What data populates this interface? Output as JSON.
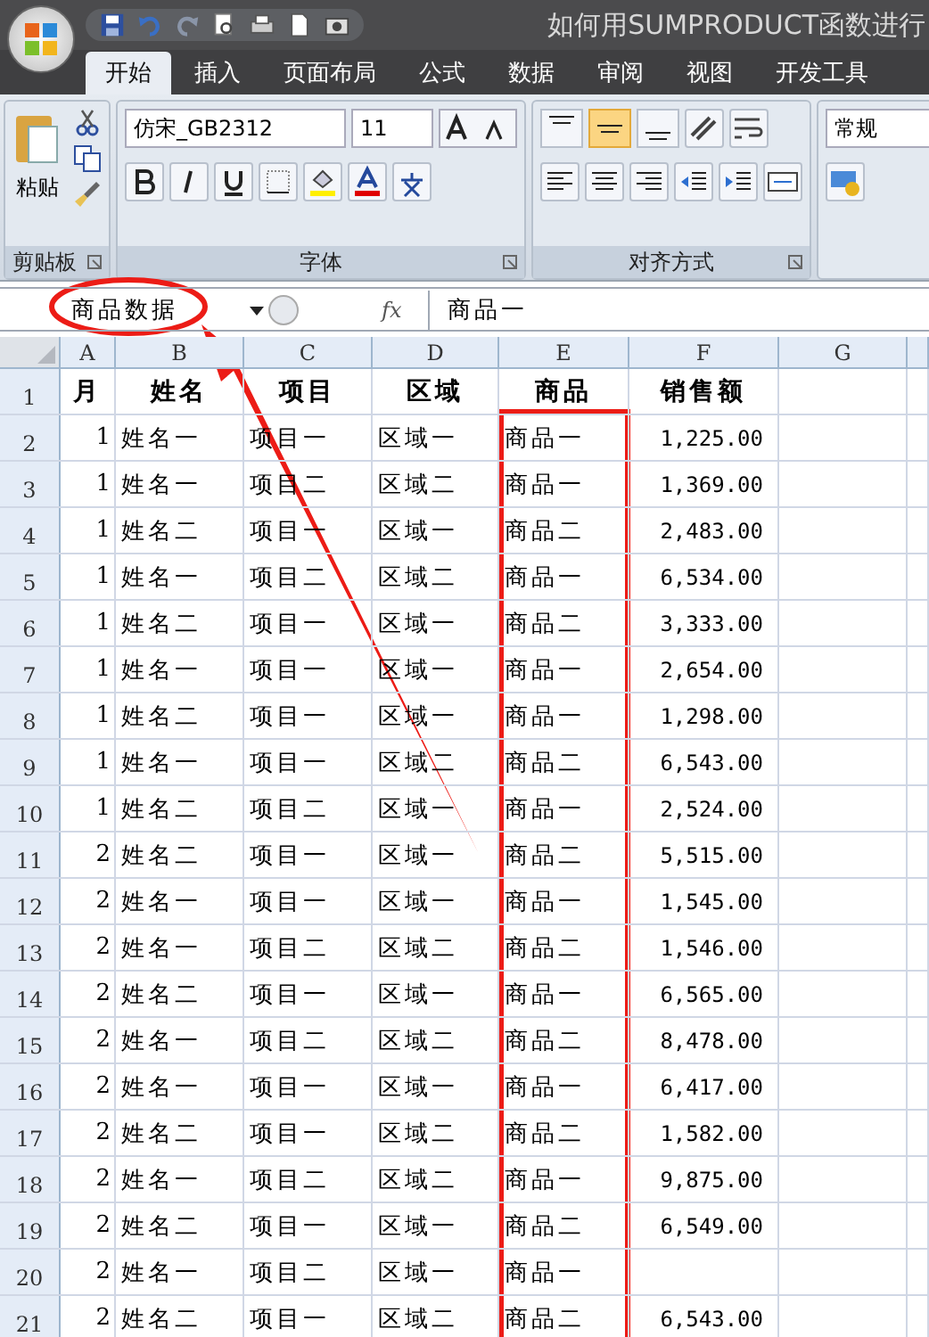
{
  "window": {
    "title": "如何用SUMPRODUCT函数进行"
  },
  "tabs": [
    {
      "label": "开始",
      "selected": true
    },
    {
      "label": "插入",
      "selected": false
    },
    {
      "label": "页面布局",
      "selected": false
    },
    {
      "label": "公式",
      "selected": false
    },
    {
      "label": "数据",
      "selected": false
    },
    {
      "label": "审阅",
      "selected": false
    },
    {
      "label": "视图",
      "selected": false
    },
    {
      "label": "开发工具",
      "selected": false
    }
  ],
  "clipboard": {
    "label": "剪贴板",
    "paste": "粘贴"
  },
  "font": {
    "label": "字体",
    "name": "仿宋_GB2312",
    "size": "11"
  },
  "alignment": {
    "label": "对齐方式",
    "vertical": [
      {
        "selected": false
      },
      {
        "selected": true
      },
      {
        "selected": false
      }
    ]
  },
  "number": {
    "format": "常规"
  },
  "formula_bar": {
    "name_box": "商品数据",
    "fx": "fx",
    "formula": "商品一"
  },
  "sheet": {
    "columns": [
      "A",
      "B",
      "C",
      "D",
      "E",
      "F",
      "G"
    ],
    "rows": [
      {
        "number": "1",
        "header": true,
        "cells": [
          "月",
          "姓名",
          "项目",
          "区域",
          "商品",
          "销售额"
        ]
      },
      {
        "number": "2",
        "header": false,
        "cells": [
          "1",
          "姓名一",
          "项目一",
          "区域一",
          "商品一",
          "1,225.00"
        ]
      },
      {
        "number": "3",
        "header": false,
        "cells": [
          "1",
          "姓名一",
          "项目二",
          "区域二",
          "商品一",
          "1,369.00"
        ]
      },
      {
        "number": "4",
        "header": false,
        "cells": [
          "1",
          "姓名二",
          "项目一",
          "区域一",
          "商品二",
          "2,483.00"
        ]
      },
      {
        "number": "5",
        "header": false,
        "cells": [
          "1",
          "姓名一",
          "项目二",
          "区域二",
          "商品一",
          "6,534.00"
        ]
      },
      {
        "number": "6",
        "header": false,
        "cells": [
          "1",
          "姓名二",
          "项目一",
          "区域一",
          "商品二",
          "3,333.00"
        ]
      },
      {
        "number": "7",
        "header": false,
        "cells": [
          "1",
          "姓名一",
          "项目一",
          "区域一",
          "商品一",
          "2,654.00"
        ]
      },
      {
        "number": "8",
        "header": false,
        "cells": [
          "1",
          "姓名二",
          "项目一",
          "区域一",
          "商品一",
          "1,298.00"
        ]
      },
      {
        "number": "9",
        "header": false,
        "cells": [
          "1",
          "姓名一",
          "项目一",
          "区域二",
          "商品二",
          "6,543.00"
        ]
      },
      {
        "number": "10",
        "header": false,
        "cells": [
          "1",
          "姓名二",
          "项目二",
          "区域一",
          "商品一",
          "2,524.00"
        ]
      },
      {
        "number": "11",
        "header": false,
        "cells": [
          "2",
          "姓名二",
          "项目一",
          "区域一",
          "商品二",
          "5,515.00"
        ]
      },
      {
        "number": "12",
        "header": false,
        "cells": [
          "2",
          "姓名一",
          "项目一",
          "区域一",
          "商品一",
          "1,545.00"
        ]
      },
      {
        "number": "13",
        "header": false,
        "cells": [
          "2",
          "姓名一",
          "项目二",
          "区域二",
          "商品二",
          "1,546.00"
        ]
      },
      {
        "number": "14",
        "header": false,
        "cells": [
          "2",
          "姓名二",
          "项目一",
          "区域一",
          "商品一",
          "6,565.00"
        ]
      },
      {
        "number": "15",
        "header": false,
        "cells": [
          "2",
          "姓名一",
          "项目二",
          "区域二",
          "商品二",
          "8,478.00"
        ]
      },
      {
        "number": "16",
        "header": false,
        "cells": [
          "2",
          "姓名一",
          "项目一",
          "区域一",
          "商品一",
          "6,417.00"
        ]
      },
      {
        "number": "17",
        "header": false,
        "cells": [
          "2",
          "姓名二",
          "项目一",
          "区域二",
          "商品二",
          "1,582.00"
        ]
      },
      {
        "number": "18",
        "header": false,
        "cells": [
          "2",
          "姓名一",
          "项目二",
          "区域二",
          "商品一",
          "9,875.00"
        ]
      },
      {
        "number": "19",
        "header": false,
        "cells": [
          "2",
          "姓名二",
          "项目一",
          "区域一",
          "商品二",
          "6,549.00"
        ]
      },
      {
        "number": "20",
        "header": false,
        "cells": [
          "2",
          "姓名一",
          "项目二",
          "区域一",
          "商品一"
        ]
      },
      {
        "number": "21",
        "header": false,
        "cells": [
          "2",
          "姓名二",
          "项目一",
          "区域二",
          "商品二",
          "6,543.00"
        ]
      }
    ]
  }
}
